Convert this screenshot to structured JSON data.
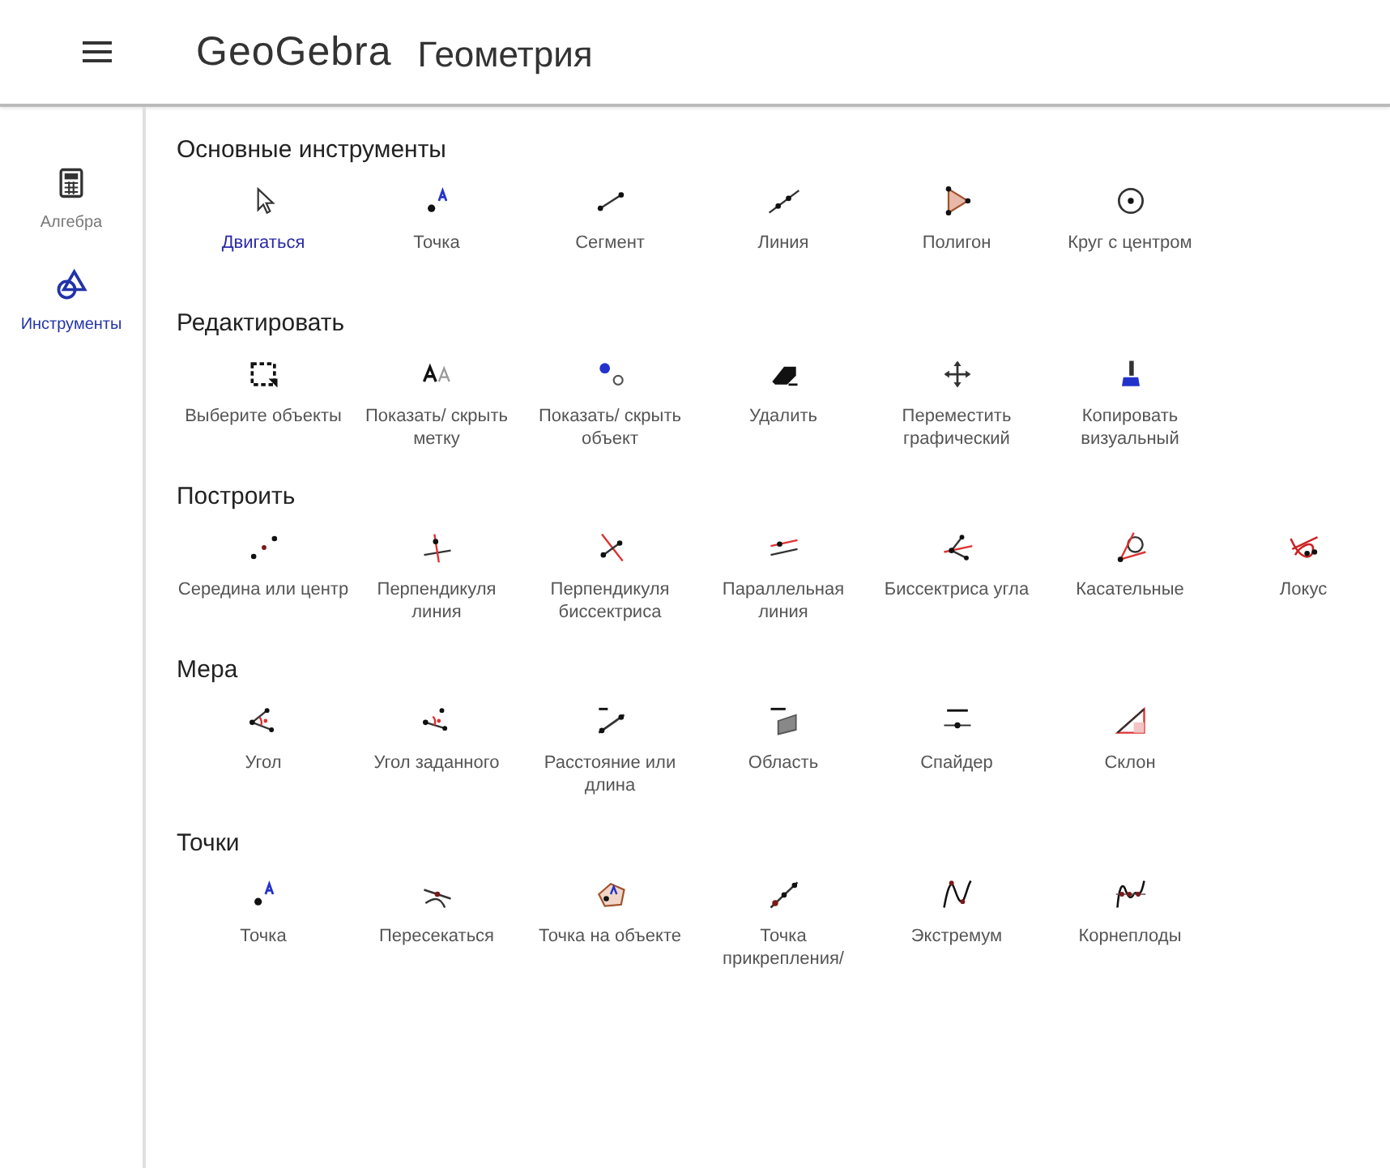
{
  "header": {
    "logo": "GeoGebra",
    "title": "Геометрия"
  },
  "sidebar": {
    "items": [
      {
        "label": "Алгебра",
        "kind": "calculator",
        "selected": false
      },
      {
        "label": "Инструменты",
        "kind": "shapes",
        "selected": true
      }
    ]
  },
  "sections": [
    {
      "title": "Основные инструменты",
      "tools": [
        {
          "label": "Двигаться",
          "kind": "move",
          "selected": true
        },
        {
          "label": "Точка",
          "kind": "point",
          "selected": false
        },
        {
          "label": "Сегмент",
          "kind": "segment",
          "selected": false
        },
        {
          "label": "Линия",
          "kind": "line",
          "selected": false
        },
        {
          "label": "Полигон",
          "kind": "polygon",
          "selected": false
        },
        {
          "label": "Круг с центром",
          "kind": "circle",
          "selected": false
        }
      ]
    },
    {
      "title": "Редактировать",
      "tools": [
        {
          "label": "Выберите объекты",
          "kind": "select",
          "selected": false
        },
        {
          "label": "Показать/ скрыть метку",
          "kind": "label",
          "selected": false
        },
        {
          "label": "Показать/ скрыть объект",
          "kind": "showhide",
          "selected": false
        },
        {
          "label": "Удалить",
          "kind": "delete",
          "selected": false
        },
        {
          "label": "Переместить графический",
          "kind": "pan",
          "selected": false
        },
        {
          "label": "Копировать визуальный",
          "kind": "brush",
          "selected": false
        }
      ]
    },
    {
      "title": "Построить",
      "tools": [
        {
          "label": "Середина или центр",
          "kind": "midpoint",
          "selected": false
        },
        {
          "label": "Перпендикуля линия",
          "kind": "perpendicular",
          "selected": false
        },
        {
          "label": "Перпендикуля биссектриса",
          "kind": "bisector",
          "selected": false
        },
        {
          "label": "Параллельная линия",
          "kind": "parallel",
          "selected": false
        },
        {
          "label": "Биссектриса угла",
          "kind": "anglebisector",
          "selected": false
        },
        {
          "label": "Касательные",
          "kind": "tangent",
          "selected": false
        },
        {
          "label": "Локус",
          "kind": "locus",
          "selected": false
        }
      ]
    },
    {
      "title": "Мера",
      "tools": [
        {
          "label": "Угол",
          "kind": "angle",
          "selected": false
        },
        {
          "label": "Угол заданного",
          "kind": "anglesize",
          "selected": false
        },
        {
          "label": "Расстояние или длина",
          "kind": "distance",
          "selected": false
        },
        {
          "label": "Область",
          "kind": "area",
          "selected": false
        },
        {
          "label": "Спайдер",
          "kind": "slider",
          "selected": false
        },
        {
          "label": "Склон",
          "kind": "slope",
          "selected": false
        }
      ]
    },
    {
      "title": "Точки",
      "tools": [
        {
          "label": "Точка",
          "kind": "point",
          "selected": false
        },
        {
          "label": "Пересекаться",
          "kind": "intersect",
          "selected": false
        },
        {
          "label": "Точка на объекте",
          "kind": "pointonobject",
          "selected": false
        },
        {
          "label": "Точка прикрепления/",
          "kind": "attach",
          "selected": false
        },
        {
          "label": "Экстремум",
          "kind": "extremum",
          "selected": false
        },
        {
          "label": "Корнеплоды",
          "kind": "roots",
          "selected": false
        }
      ]
    }
  ]
}
